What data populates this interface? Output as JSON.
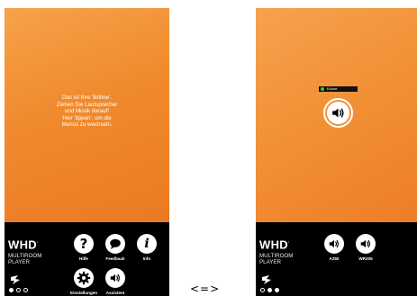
{
  "left_screen": {
    "stage_message": "Das ist Ihre 'Bühne'.\nZiehen Sie Lautsprecher\nund Musik darauf!\nHier 'tippen', um die\nMenüs zu wechseln.",
    "brand": {
      "logo": "WHD",
      "subtitle": "MULTIROOM\nPLAYER"
    },
    "buttons": [
      {
        "label": "Hilfe",
        "icon": "question-icon",
        "glyph": "?"
      },
      {
        "label": "Feedback",
        "icon": "chat-bubble-icon"
      },
      {
        "label": "Info",
        "icon": "info-icon",
        "glyph": "i"
      },
      {
        "label": "Einstellungen",
        "icon": "gear-icon"
      },
      {
        "label": "Assistent",
        "icon": "speaker-icon"
      }
    ],
    "page_indicator": {
      "total": 3,
      "active": 1
    }
  },
  "separator": "<=>",
  "right_screen": {
    "stage_speaker": {
      "name": "Küche",
      "status_color": "#27d23a",
      "icon": "speaker-icon"
    },
    "brand": {
      "logo": "WHD",
      "subtitle": "MULTIROOM\nPLAYER"
    },
    "buttons": [
      {
        "label": "A250",
        "icon": "speaker-icon"
      },
      {
        "label": "WR205",
        "icon": "speaker-icon"
      }
    ],
    "page_indicator": {
      "total": 3,
      "active": 2
    }
  },
  "colors": {
    "stage": "#f08a2e",
    "dock": "#000000",
    "accent": "#ffffff",
    "status_led": "#27d23a"
  }
}
